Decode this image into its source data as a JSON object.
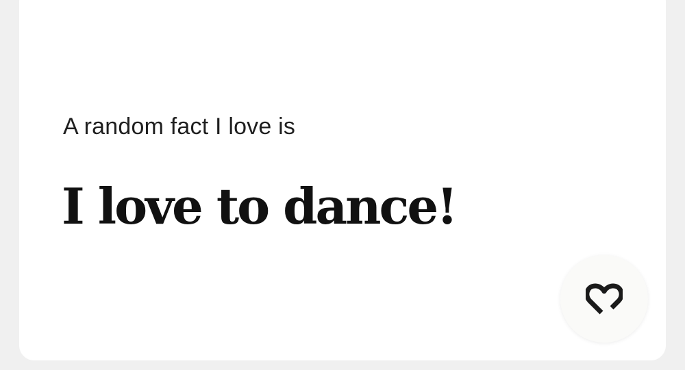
{
  "prompt": {
    "label": "A random fact I love is",
    "answer": "I love to dance!"
  },
  "like_button": {
    "icon": "heart-icon",
    "aria_label": "Like"
  }
}
